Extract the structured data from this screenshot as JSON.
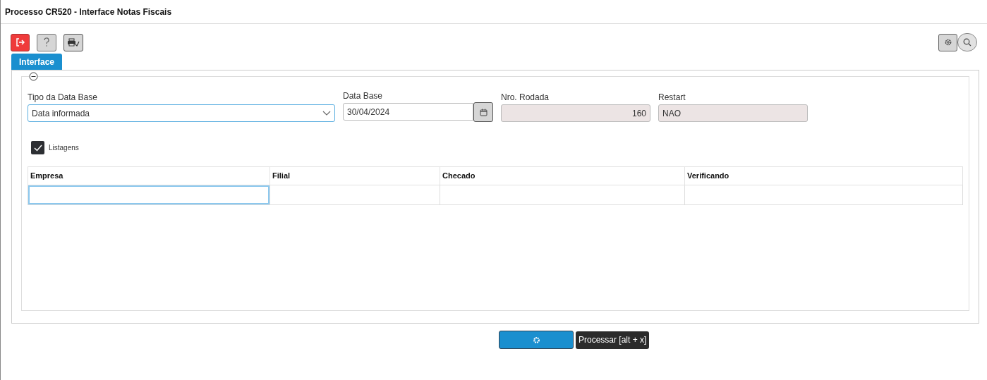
{
  "window": {
    "title": "Processo CR520 - Interface Notas Fiscais"
  },
  "tabs": [
    {
      "label": "Interface",
      "selected": true
    }
  ],
  "form": {
    "fields": [
      {
        "kind": "select",
        "label": "Tipo da Data Base",
        "value": "Data informada"
      },
      {
        "kind": "date",
        "label": "Data Base",
        "value": "30/04/2024"
      },
      {
        "kind": "readonly-number",
        "label": "Nro. Rodada",
        "value": "160"
      },
      {
        "kind": "readonly",
        "label": "Restart",
        "value": "NAO"
      }
    ],
    "checkbox": {
      "label": "Listagens",
      "checked": true
    }
  },
  "table": {
    "columns": [
      "Empresa",
      "Filial",
      "Checado",
      "Verificando"
    ]
  },
  "tooltip": "Processar [alt + x]"
}
